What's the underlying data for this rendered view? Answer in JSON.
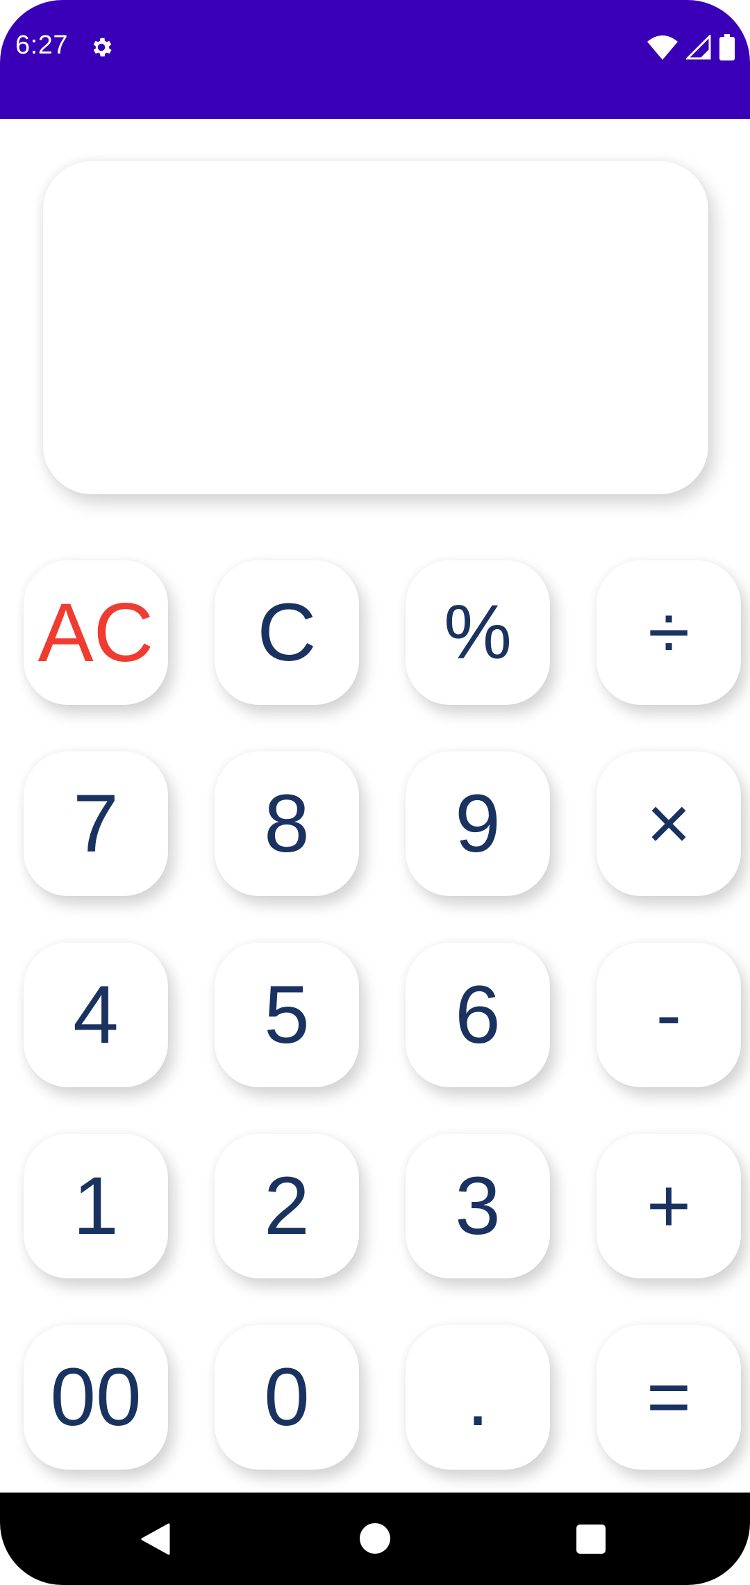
{
  "status_bar": {
    "time": "6:27",
    "icons": [
      "gear-icon",
      "wifi-icon",
      "signal-icon",
      "battery-icon"
    ],
    "background": "#3a00b8"
  },
  "display": {
    "expression": "",
    "result": ""
  },
  "keys": {
    "ac": "AC",
    "c": "C",
    "percent": "%",
    "divide": "÷",
    "seven": "7",
    "eight": "8",
    "nine": "9",
    "multiply": "×",
    "four": "4",
    "five": "5",
    "six": "6",
    "minus": "-",
    "one": "1",
    "two": "2",
    "three": "3",
    "plus": "+",
    "double_zero": "00",
    "zero": "0",
    "dot": ".",
    "equals": "="
  },
  "colors": {
    "digit": "#1a3260",
    "clear_all": "#f03c30"
  },
  "nav_bar": {
    "icons": [
      "back-icon",
      "home-icon",
      "recents-icon"
    ]
  }
}
